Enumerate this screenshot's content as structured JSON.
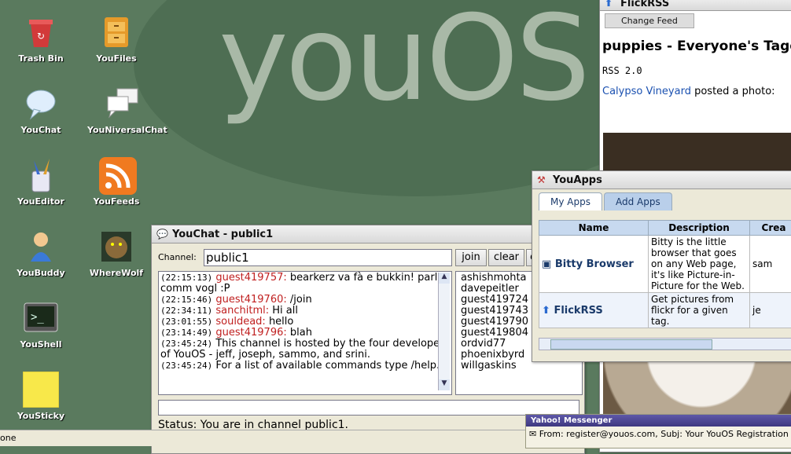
{
  "desktop": {
    "logo": "youOS",
    "icons": [
      {
        "label": "Trash Bin"
      },
      {
        "label": "YouFiles"
      },
      {
        "label": "YouChat"
      },
      {
        "label": "YouNiversalChat"
      },
      {
        "label": "YouEditor"
      },
      {
        "label": "YouFeeds"
      },
      {
        "label": "YouBuddy"
      },
      {
        "label": "WhereWolf"
      },
      {
        "label": "YouShell"
      },
      {
        "label": "YouSticky"
      }
    ]
  },
  "flickrss": {
    "title": "FlickRSS",
    "change_feed": "Change Feed",
    "feed_title": "puppies - Everyone's Tagged Photos",
    "rss_version": "RSS 2.0",
    "author": "Calypso Vineyard",
    "posted": "posted a photo:"
  },
  "youapps": {
    "title": "YouApps",
    "tabs": [
      "My Apps",
      "Add Apps"
    ],
    "headers": [
      "Name",
      "Description",
      "Crea"
    ],
    "rows": [
      {
        "name": "Bitty Browser",
        "desc": "Bitty is the little browser that goes on any Web page, it's like Picture-in-Picture for the Web.",
        "creator": "sam"
      },
      {
        "name": "FlickRSS",
        "desc": "Get pictures from flickr for a given tag.",
        "creator": "je"
      }
    ]
  },
  "youchat": {
    "title": "YouChat - public1",
    "channel_label": "Channel:",
    "channel_value": "public1",
    "join": "join",
    "clear": "clear",
    "extra_btn": "c",
    "messages": [
      {
        "ts": "(22:15:13)",
        "user": "guest419757:",
        "text": " bearkerz va fà e bukkin! parl comm vogl :P"
      },
      {
        "ts": "(22:15:46)",
        "user": "guest419760:",
        "text": " /join"
      },
      {
        "ts": "(22:34:11)",
        "user": "sanchitml:",
        "text": " Hi all"
      },
      {
        "ts": "(23:01:55)",
        "user": "souldead:",
        "text": " hello"
      },
      {
        "ts": "(23:14:49)",
        "user": "guest419796:",
        "text": " blah"
      },
      {
        "ts": "(23:45:24)",
        "user": "",
        "text": " This channel is hosted by the four developers of YouOS - jeff, joseph, sammo, and srini."
      },
      {
        "ts": "(23:45:24)",
        "user": "",
        "text": " For a list of available commands type /help."
      }
    ],
    "users": [
      "ashishmohta",
      "davepeitler",
      "guest419724",
      "guest419743",
      "guest419790",
      "guest419804",
      "ordvid77",
      "phoenixbyrd",
      "willgaskins"
    ],
    "status": "Status: You are in channel public1."
  },
  "yahoo": {
    "title": "Yahoo! Messenger",
    "message": "From: register@youos.com, Subj: Your YouOS Registration C"
  },
  "statusbar": {
    "text": "one"
  }
}
